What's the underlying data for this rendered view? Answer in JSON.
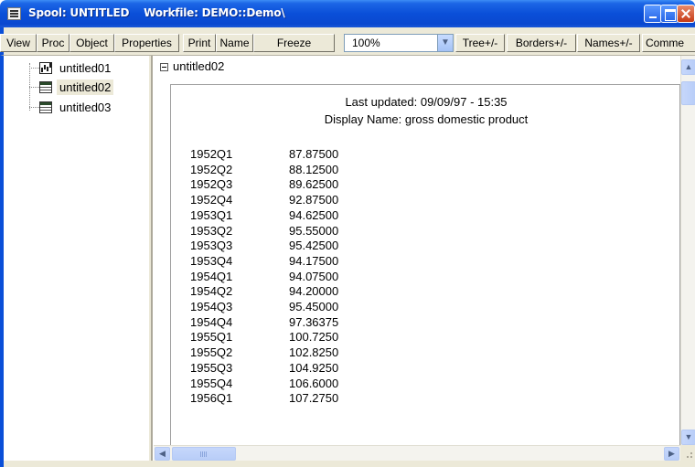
{
  "window": {
    "title": "Spool: UNTITLED    Workfile: DEMO::Demo\\"
  },
  "toolbar": {
    "buttons": [
      {
        "label": "View"
      },
      {
        "label": "Proc"
      },
      {
        "label": "Object"
      },
      {
        "label": "Properties"
      },
      {
        "label": "Print"
      },
      {
        "label": "Name"
      },
      {
        "label": "Freeze"
      },
      {
        "label": "Tree+/-"
      },
      {
        "label": "Borders+/-"
      },
      {
        "label": "Names+/-"
      },
      {
        "label": "Comme"
      }
    ],
    "zoom": "100%"
  },
  "tree": {
    "items": [
      {
        "label": "untitled01",
        "icon": "graph-icon"
      },
      {
        "label": "untitled02",
        "icon": "table-icon",
        "selected": true
      },
      {
        "label": "untitled03",
        "icon": "table-icon"
      }
    ]
  },
  "content": {
    "header": "untitled02",
    "last_updated": "Last updated: 09/09/97 - 15:35",
    "display_name": "Display Name: gross domestic product",
    "rows": [
      {
        "period": "1952Q1",
        "value": "87.87500"
      },
      {
        "period": "1952Q2",
        "value": "88.12500"
      },
      {
        "period": "1952Q3",
        "value": "89.62500"
      },
      {
        "period": "1952Q4",
        "value": "92.87500"
      },
      {
        "period": "1953Q1",
        "value": "94.62500"
      },
      {
        "period": "1953Q2",
        "value": "95.55000"
      },
      {
        "period": "1953Q3",
        "value": "95.42500"
      },
      {
        "period": "1953Q4",
        "value": "94.17500"
      },
      {
        "period": "1954Q1",
        "value": "94.07500"
      },
      {
        "period": "1954Q2",
        "value": "94.20000"
      },
      {
        "period": "1954Q3",
        "value": "95.45000"
      },
      {
        "period": "1954Q4",
        "value": "97.36375"
      },
      {
        "period": "1955Q1",
        "value": "100.7250"
      },
      {
        "period": "1955Q2",
        "value": "102.8250"
      },
      {
        "period": "1955Q3",
        "value": "104.9250"
      },
      {
        "period": "1955Q4",
        "value": "106.6000"
      },
      {
        "period": "1956Q1",
        "value": "107.2750"
      }
    ]
  }
}
